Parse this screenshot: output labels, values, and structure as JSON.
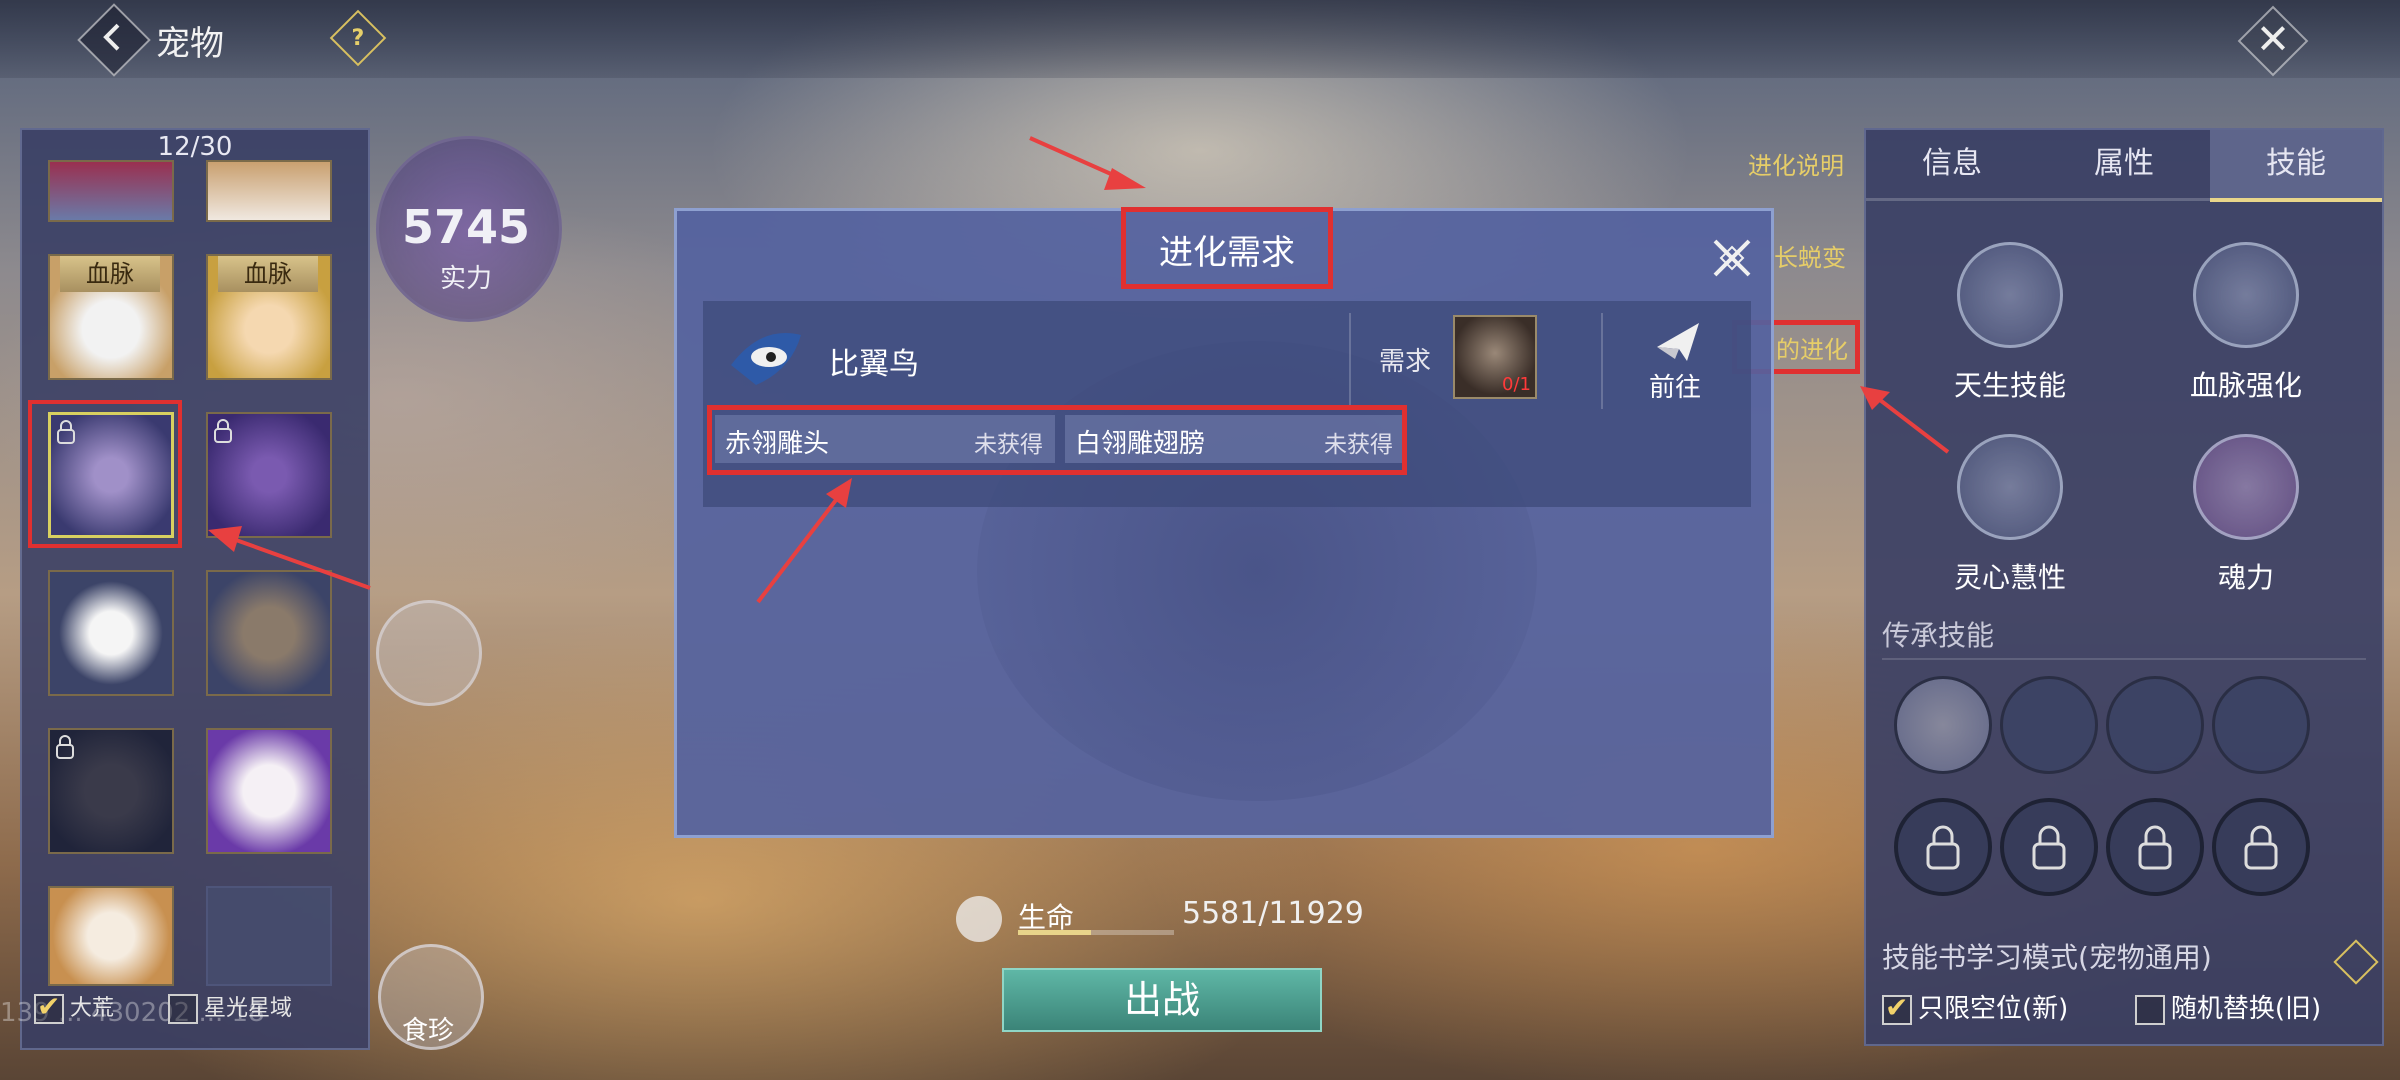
{
  "header": {
    "title": "宠物",
    "help": "?"
  },
  "pet_panel": {
    "count": "12/30",
    "slots": [
      {
        "tag": ""
      },
      {
        "tag": ""
      },
      {
        "tag": "血脉"
      },
      {
        "tag": "血脉"
      }
    ],
    "filters": [
      {
        "label": "大荒",
        "checked": true
      },
      {
        "label": "星光星域",
        "checked": false
      }
    ]
  },
  "power": {
    "value": "5745",
    "label": "实力"
  },
  "food": {
    "label": "食珍"
  },
  "watermark": "139 ... 430202 ... 18",
  "side_tabs": [
    "进化说明",
    "长蜕变",
    "的进化"
  ],
  "modal": {
    "title": "进化需求",
    "pet_name": "比翼鸟",
    "need_label": "需求",
    "item_count": "0/1",
    "goto_label": "前往",
    "materials": [
      {
        "name": "赤翎雕头",
        "status": "未获得"
      },
      {
        "name": "白翎雕翅膀",
        "status": "未获得"
      }
    ]
  },
  "right_panel": {
    "tabs": [
      "信息",
      "属性",
      "技能"
    ],
    "active_tab": "技能",
    "skills": [
      "天生技能",
      "血脉强化",
      "灵心慧性",
      "魂力"
    ],
    "inherit_title": "传承技能",
    "book_title": "技能书学习模式(宠物通用)",
    "options": [
      {
        "label": "只限空位(新)",
        "checked": true
      },
      {
        "label": "随机替换(旧)",
        "checked": false
      }
    ]
  },
  "status": {
    "life_label": "生命",
    "life_value": "5581/11929",
    "life_fraction": 0.468,
    "deploy_label": "出战"
  },
  "colors": {
    "highlight": "#e03030",
    "gold": "#e6cd68",
    "panel": "#383e64"
  }
}
